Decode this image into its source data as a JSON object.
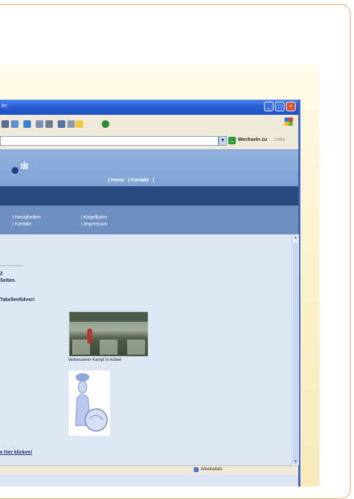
{
  "window": {
    "title": "ier",
    "controls": {
      "minimize": "_",
      "maximize": "□",
      "close": "×"
    }
  },
  "address_bar": {
    "go_label": "Wechseln zu",
    "links_label": "Links"
  },
  "site": {
    "top_nav": [
      "| Home",
      "| Kontakt",
      "|"
    ],
    "subnav": {
      "neuigkeiten": "| Neuigkeiten",
      "kegelbahn": "| Kegelbahn",
      "kontakt": "| Kontakt",
      "impressum": "| Impressum"
    }
  },
  "content": {
    "heading_lines": [
      "2",
      "Seiten.",
      "Tabellenführer!"
    ],
    "photo_caption": "Verbessener Kampf in Asbert",
    "bottom_link": "e hier klicken!"
  },
  "status_bar": {
    "zone": "Arbeitsplatz"
  },
  "colors": {
    "titlebar": "#2b5dd6",
    "nav_band": "#254a7d",
    "subnav": "#6e8fc0",
    "content_bg": "#dde7f4"
  }
}
